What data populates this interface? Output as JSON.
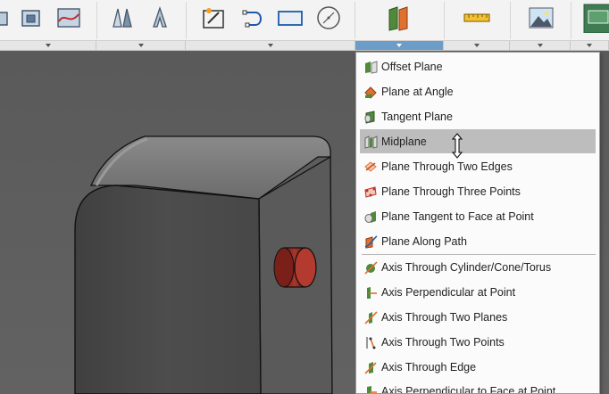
{
  "toolbar": {
    "groups": [
      {
        "icons": [
          "box-icon",
          "shell-icon",
          "surface-icon"
        ]
      },
      {
        "icons": [
          "mirror-icon",
          "pattern-icon"
        ]
      },
      {
        "icons": [
          "sketch-icon",
          "spline-icon",
          "rectangle-icon",
          "circle-icon"
        ]
      },
      {
        "icons": [
          "work-plane-icon"
        ],
        "active": true
      },
      {
        "icons": [
          "measure-icon"
        ]
      },
      {
        "icons": [
          "image-icon"
        ]
      },
      {
        "icons": [
          "select-icon"
        ]
      }
    ]
  },
  "menu": {
    "planes": [
      {
        "label": "Offset Plane",
        "icon": "offset-plane-icon"
      },
      {
        "label": "Plane at Angle",
        "icon": "plane-at-angle-icon"
      },
      {
        "label": "Tangent Plane",
        "icon": "tangent-plane-icon"
      },
      {
        "label": "Midplane",
        "icon": "midplane-icon",
        "highlighted": true
      },
      {
        "label": "Plane Through Two Edges",
        "icon": "plane-two-edges-icon"
      },
      {
        "label": "Plane Through Three Points",
        "icon": "plane-three-points-icon"
      },
      {
        "label": "Plane Tangent to Face at Point",
        "icon": "plane-tangent-face-icon"
      },
      {
        "label": "Plane Along Path",
        "icon": "plane-along-path-icon"
      }
    ],
    "axes": [
      {
        "label": "Axis Through Cylinder/Cone/Torus",
        "icon": "axis-cylinder-icon"
      },
      {
        "label": "Axis Perpendicular at Point",
        "icon": "axis-perpendicular-icon"
      },
      {
        "label": "Axis Through Two Planes",
        "icon": "axis-two-planes-icon"
      },
      {
        "label": "Axis Through Two Points",
        "icon": "axis-two-points-icon"
      },
      {
        "label": "Axis Through Edge",
        "icon": "axis-edge-icon"
      },
      {
        "label": "Axis Perpendicular to Face at Point",
        "icon": "axis-perpendicular-face-icon"
      }
    ]
  },
  "colors": {
    "accent": "#6c9dc9",
    "highlight": "#bdbdbd",
    "model_body": "#4a4a4a",
    "cylinder": "#9a2a22",
    "plane_green": "#4f8a3a",
    "plane_orange": "#e07030"
  }
}
